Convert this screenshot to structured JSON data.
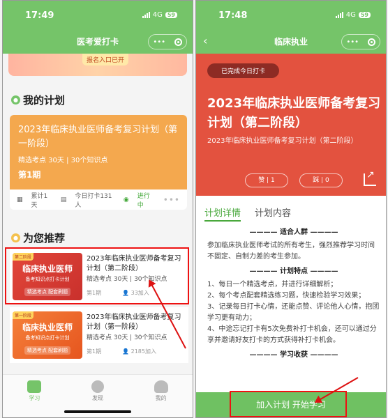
{
  "status": {
    "time": "17:49",
    "network": "4G",
    "battery": "59"
  },
  "status_right": {
    "time": "17:48",
    "network": "4G",
    "battery": "59"
  },
  "left": {
    "nav_title": "医考爱打卡",
    "banner_tag": "报名入口已开",
    "my_plan": {
      "heading": "我的计划",
      "name": "2023年临床执业医师备考复习计划（第一阶段）",
      "meta": "精选考点 30天 | 30个知识点",
      "period": "第1期",
      "foot": {
        "total": "累计1天",
        "today": "今日打卡131人",
        "status": "进行中",
        "more": "•••"
      }
    },
    "recommend": {
      "heading": "为您推荐",
      "items": [
        {
          "corner": "第二阶段",
          "thumb_title": "临床执业医师",
          "thumb_sub": "备考知识点打卡计划",
          "thumb_tags": "精选考点 配套刷题",
          "name": "2023年临床执业医师备考复习计划（第二阶段）",
          "meta": "精选考点 30天 | 30个知识点",
          "period": "第1期",
          "joined": "33加入"
        },
        {
          "corner": "第一阶段",
          "thumb_title": "临床执业医师",
          "thumb_sub": "备考知识点打卡计划",
          "thumb_tags": "精选考点 配套刷题",
          "name": "2023年临床执业医师备考复习计划（第一阶段）",
          "meta": "精选考点 30天 | 30个知识点",
          "period": "第1期",
          "joined": "2185加入"
        }
      ]
    },
    "tabs": [
      "学习",
      "发现",
      "我的"
    ]
  },
  "right": {
    "nav_title": "临床执业",
    "done_badge": "已完成今日打卡",
    "title": "2023年临床执业医师备考复习计划（第二阶段）",
    "subtitle": "2023年临床执业医师备考复习计划（第二阶段）",
    "like": "赞 | 1",
    "dislike": "踩 | 0",
    "tabs": [
      "计划详情",
      "计划内容"
    ],
    "sections": [
      {
        "heading": "———— 适合人群 ————",
        "lines": [
          "参加临床执业医师考试的所有考生，强烈推荐学习时间不固定、自制力差的考生参加。"
        ]
      },
      {
        "heading": "———— 计划特点 ————",
        "lines": [
          "1、每日一个精选考点，并进行详细解析；",
          "2、每个考点配套精选练习题，快速检验学习效果；",
          "3、记录每日打卡心情，还能点赞、评论他人心情，抱团学习更有动力；",
          "4、中途忘记打卡有5次免费补打卡机会，还可以通过分享并邀请好友打卡的方式获得补打卡机会。"
        ]
      },
      {
        "heading": "———— 学习收获 ————",
        "lines": []
      }
    ],
    "cta": "加入计划 开始学习"
  },
  "colors": {
    "brand_green": "#75c469",
    "hero_red": "#e3523f",
    "plan_orange": "#f4a84e",
    "highlight_red": "#e11111"
  }
}
